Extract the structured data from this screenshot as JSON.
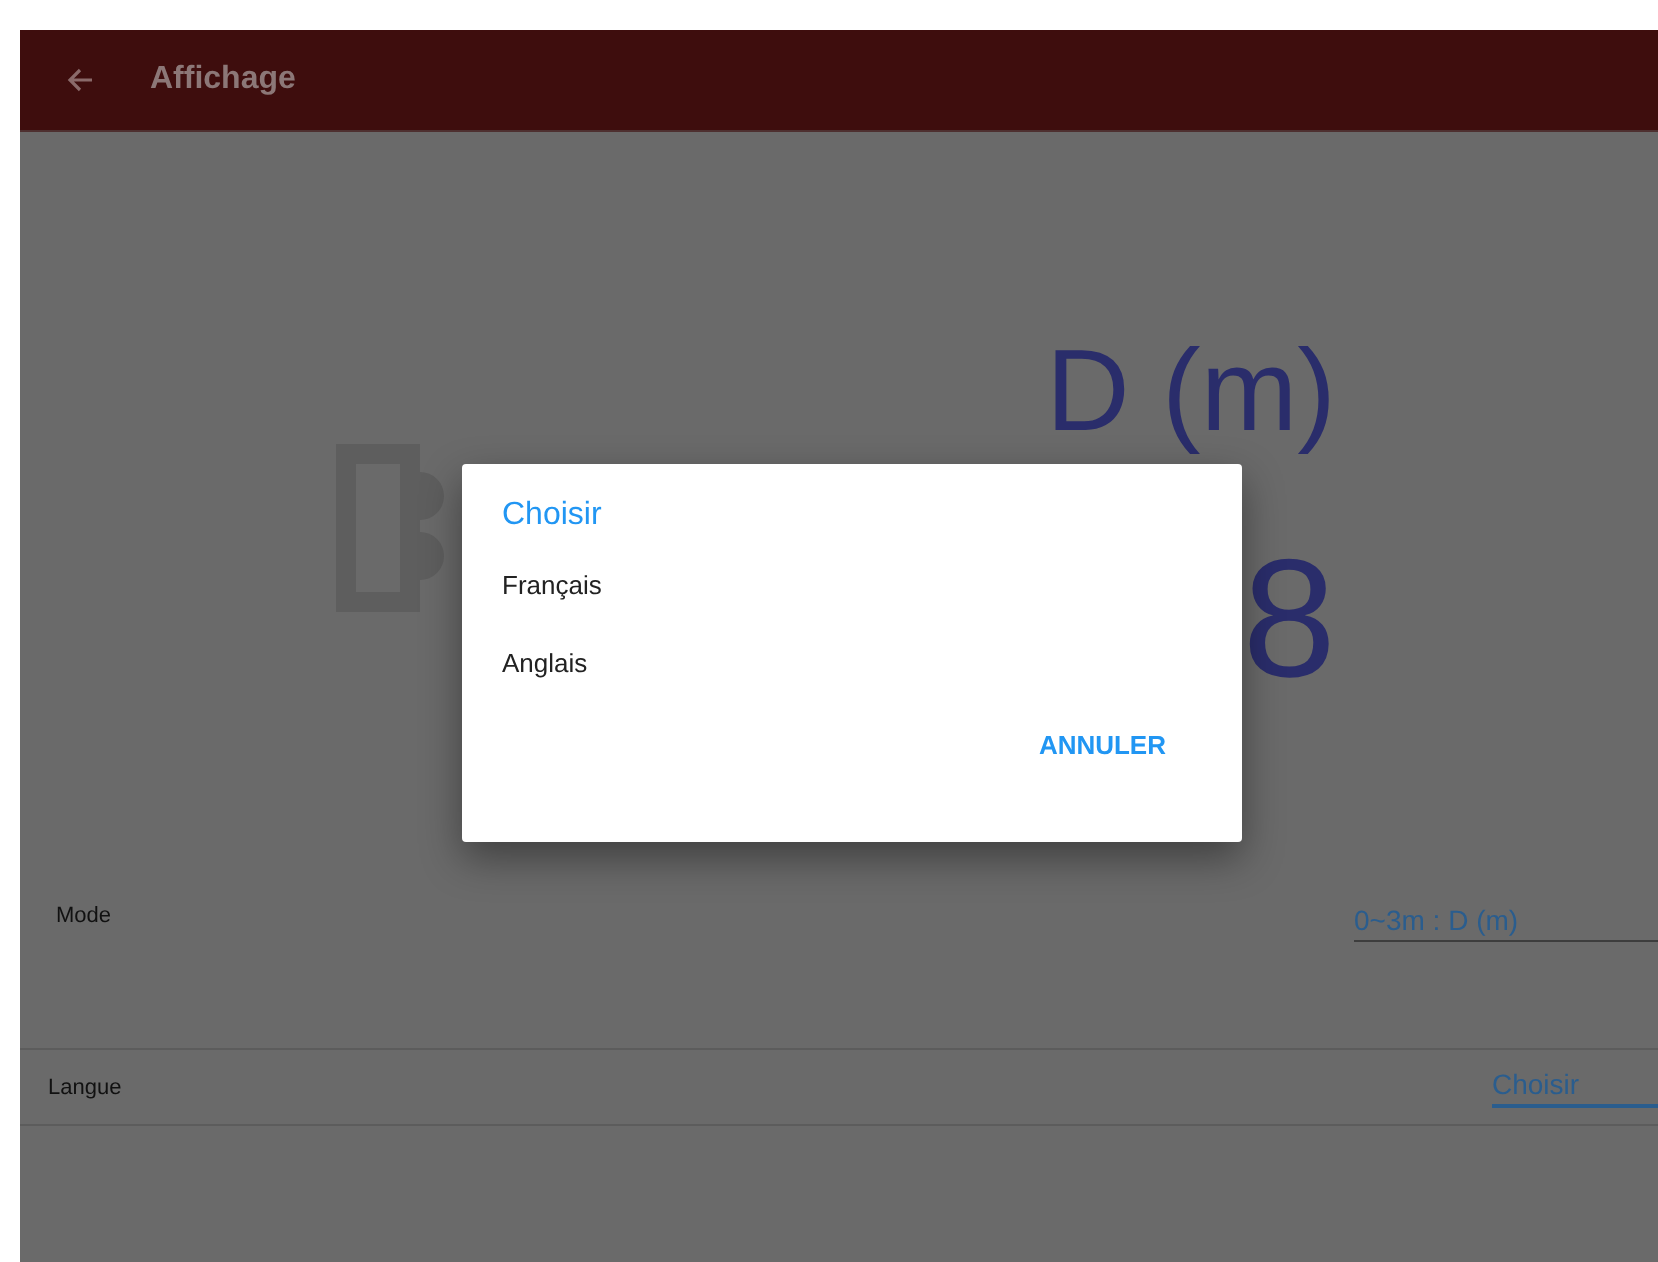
{
  "app_bar": {
    "title": "Affichage"
  },
  "display": {
    "heading": "D (m)",
    "value": "8"
  },
  "settings": [
    {
      "label": "Mode",
      "value": "0~3m : D (m)",
      "kind": "text"
    },
    {
      "label": "Langue",
      "value": "Choisir",
      "kind": "select"
    }
  ],
  "dialog": {
    "title": "Choisir",
    "options": [
      "Français",
      "Anglais"
    ],
    "buttons": [
      "ANNULER"
    ]
  }
}
